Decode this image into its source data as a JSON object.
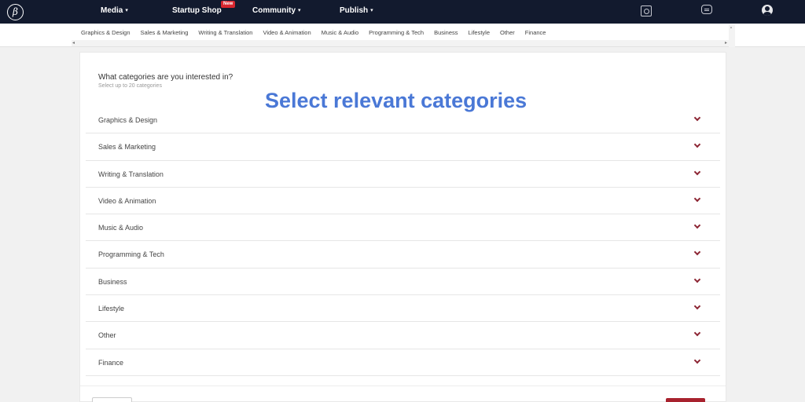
{
  "header": {
    "logo_glyph": "β",
    "nav": [
      {
        "label": "Media",
        "caret": "▾"
      },
      {
        "label": "Startup Shop",
        "badge": "New"
      },
      {
        "label": "Community",
        "caret": "▾"
      },
      {
        "label": "Publish",
        "caret": "▾"
      }
    ],
    "icons": [
      "document-icon",
      "chat-icon",
      "avatar-icon"
    ]
  },
  "subnav": {
    "items": [
      "Graphics & Design",
      "Sales & Marketing",
      "Writing & Translation",
      "Video & Animation",
      "Music & Audio",
      "Programming & Tech",
      "Business",
      "Lifestyle",
      "Other",
      "Finance"
    ],
    "scroll_left": "◂",
    "scroll_right": "▸"
  },
  "form": {
    "question": "What categories are you interested in?",
    "hint": "Select up to 20 categories",
    "overlay_title": "Select relevant categories",
    "categories": [
      "Graphics & Design",
      "Sales & Marketing",
      "Writing & Translation",
      "Video & Animation",
      "Music & Audio",
      "Programming & Tech",
      "Business",
      "Lifestyle",
      "Other",
      "Finance"
    ]
  },
  "colors": {
    "nav_bg": "#121a2e",
    "accent": "#a8222e",
    "chevron": "#8c2533",
    "overlay_text": "#4a78d6"
  }
}
